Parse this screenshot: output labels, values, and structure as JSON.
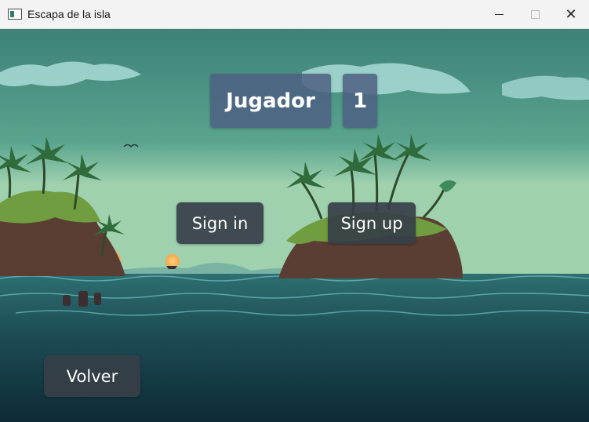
{
  "window": {
    "title": "Escapa de la isla",
    "app_icon": "app-window-icon",
    "controls": [
      "minimize-icon",
      "maximize-icon",
      "close-icon"
    ]
  },
  "player": {
    "label": "Jugador",
    "number": "1"
  },
  "buttons": {
    "sign_in": "Sign in",
    "sign_up": "Sign up",
    "back": "Volver"
  },
  "colors": {
    "sky": "#4a9287",
    "sea": "#1f4f55",
    "panel": "#4e6082",
    "button": "#363f48"
  }
}
